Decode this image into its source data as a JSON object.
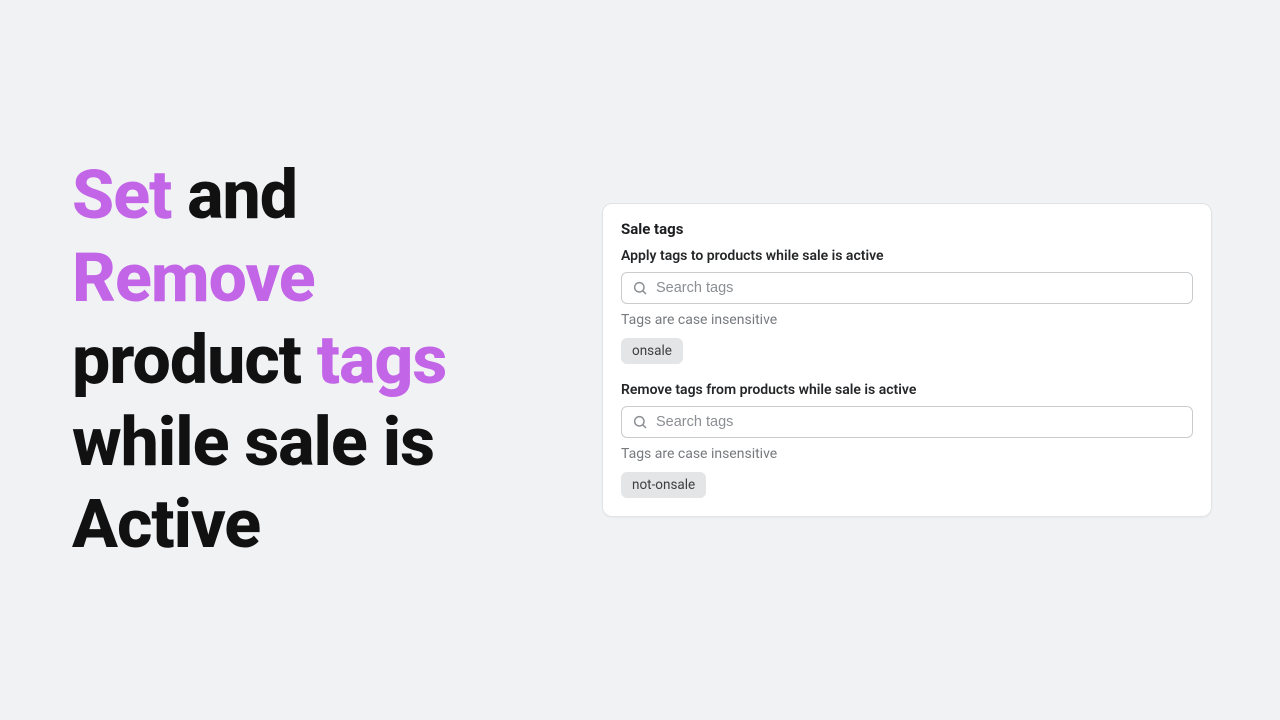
{
  "headline": {
    "w1": "Set",
    "w2": " and ",
    "w3": "Remove",
    "w4": " product ",
    "w5": "tags",
    "w6": " while sale is Active"
  },
  "card": {
    "title": "Sale tags",
    "apply": {
      "label": "Apply tags to products while sale is active",
      "placeholder": "Search tags",
      "helper": "Tags are case insensitive",
      "tag": "onsale"
    },
    "remove": {
      "label": "Remove tags from products while sale is active",
      "placeholder": "Search tags",
      "helper": "Tags are case insensitive",
      "tag": "not-onsale"
    }
  }
}
